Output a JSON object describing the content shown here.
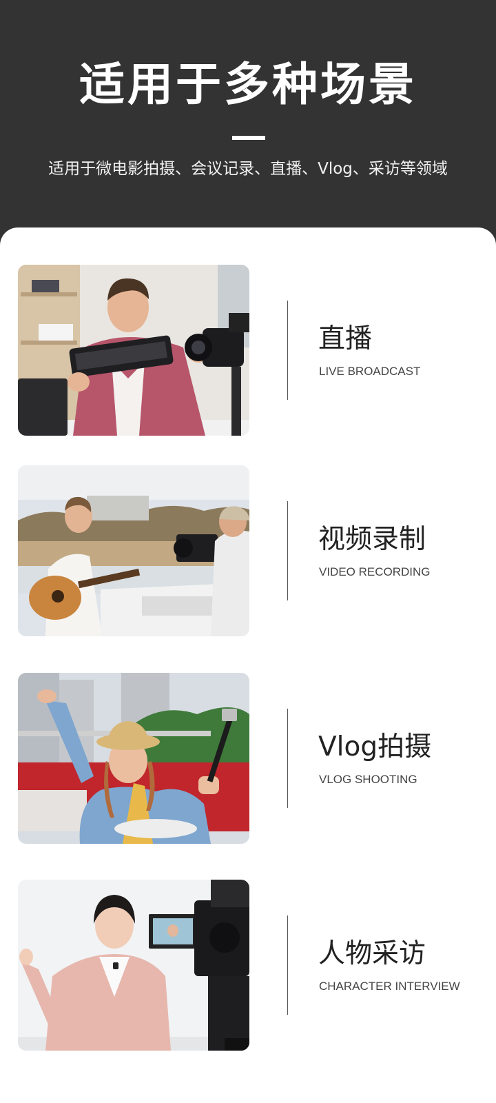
{
  "header": {
    "title": "适用于多种场景",
    "subtitle": "适用于微电影拍摄、会议记录、直播、Vlog、采访等领域"
  },
  "scenes": [
    {
      "title": "直播",
      "subtitle": "LIVE BROADCAST",
      "image_icon": "live-broadcast-photo"
    },
    {
      "title": "视频录制",
      "subtitle": "VIDEO RECORDING",
      "image_icon": "video-recording-photo"
    },
    {
      "title": "Vlog拍摄",
      "subtitle": "VLOG SHOOTING",
      "image_icon": "vlog-shooting-photo"
    },
    {
      "title": "人物采访",
      "subtitle": "CHARACTER INTERVIEW",
      "image_icon": "character-interview-photo"
    }
  ],
  "colors": {
    "header_bg": "#333333",
    "panel_bg": "#ffffff",
    "title_text": "#222222",
    "subtitle_text": "#444444"
  }
}
